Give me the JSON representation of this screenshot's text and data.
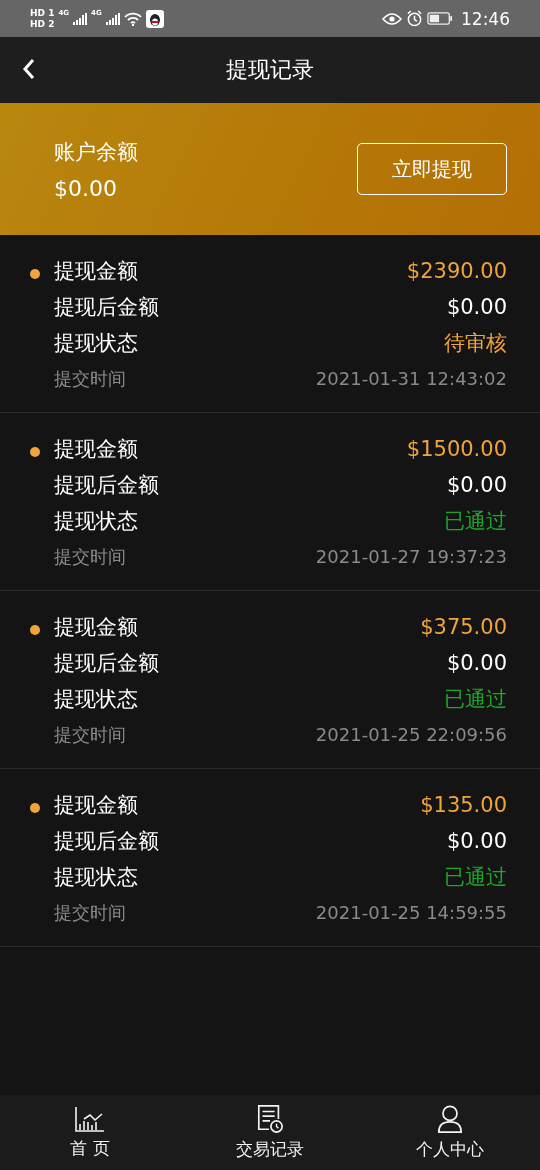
{
  "status_bar": {
    "sims": [
      {
        "label": "HD",
        "index": "1"
      },
      {
        "label": "HD",
        "index": "2"
      }
    ],
    "networks": [
      "4G",
      "4G"
    ],
    "time": "12:46"
  },
  "header": {
    "title": "提现记录"
  },
  "balance": {
    "label": "账户余额",
    "amount": "$0.00",
    "button": "立即提现"
  },
  "records": [
    {
      "amount_label": "提现金额",
      "amount": "$2390.00",
      "after_label": "提现后金额",
      "after": "$0.00",
      "status_label": "提现状态",
      "status": "待审核",
      "kind": "pending",
      "time_label": "提交时间",
      "time": "2021-01-31 12:43:02"
    },
    {
      "amount_label": "提现金额",
      "amount": "$1500.00",
      "after_label": "提现后金额",
      "after": "$0.00",
      "status_label": "提现状态",
      "status": "已通过",
      "kind": "approved",
      "time_label": "提交时间",
      "time": "2021-01-27 19:37:23"
    },
    {
      "amount_label": "提现金额",
      "amount": "$375.00",
      "after_label": "提现后金额",
      "after": "$0.00",
      "status_label": "提现状态",
      "status": "已通过",
      "kind": "approved",
      "time_label": "提交时间",
      "time": "2021-01-25 22:09:56"
    },
    {
      "amount_label": "提现金额",
      "amount": "$135.00",
      "after_label": "提现后金额",
      "after": "$0.00",
      "status_label": "提现状态",
      "status": "已通过",
      "kind": "approved",
      "time_label": "提交时间",
      "time": "2021-01-25 14:59:55"
    }
  ],
  "tab_bar": [
    {
      "label": "首 页",
      "kind": "chart",
      "selected": false
    },
    {
      "label": "交易记录",
      "kind": "document",
      "selected": false
    },
    {
      "label": "个人中心",
      "kind": "person",
      "selected": false
    }
  ]
}
